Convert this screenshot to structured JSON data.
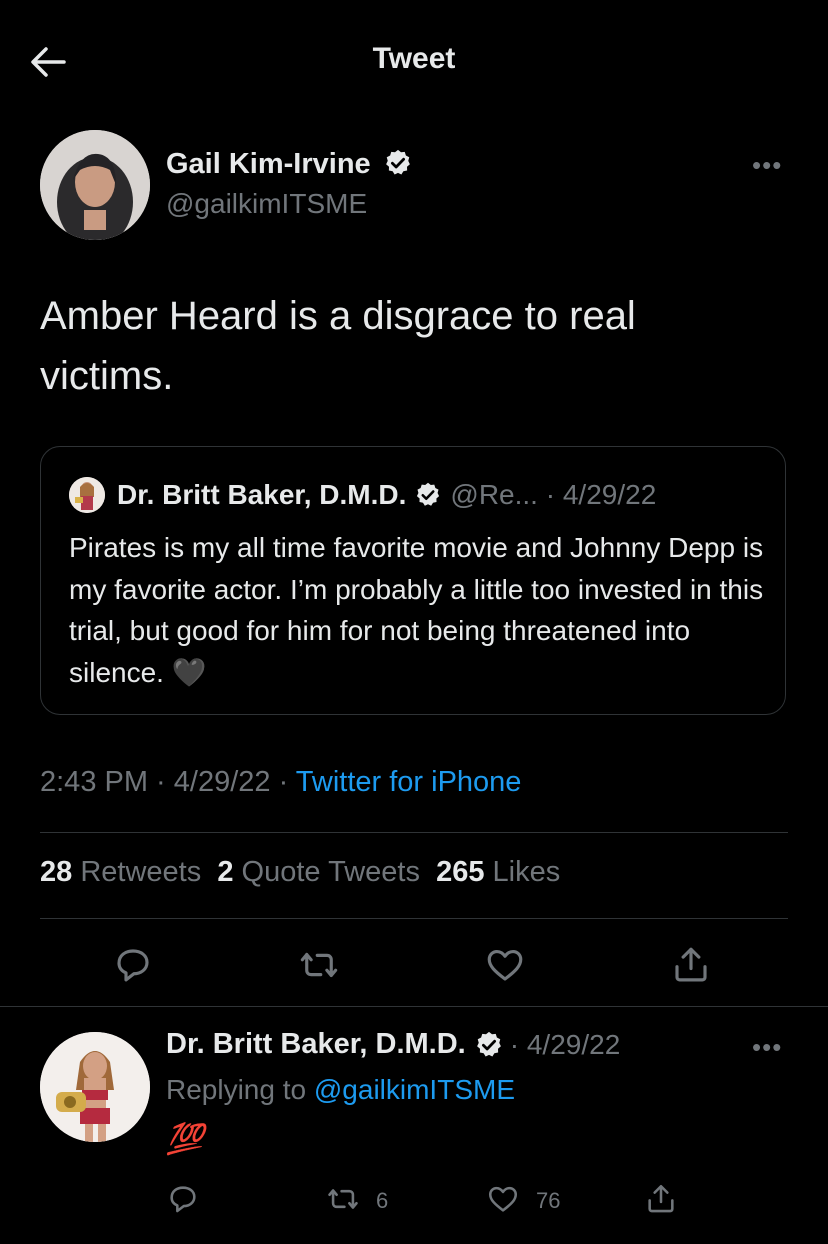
{
  "header": {
    "title": "Tweet"
  },
  "tweet": {
    "author_name": "Gail Kim-Irvine",
    "author_handle": "@gailkimITSME",
    "more": "•••",
    "text": "Amber Heard is a disgrace to real victims.",
    "quote": {
      "author_name": "Dr. Britt Baker, D.M.D.",
      "handle_date": "@Re... · 4/29/22",
      "text": "Pirates is my all time favorite movie and Johnny Depp is my favorite actor. I’m probably a little too invested in this trial, but good for him for not being threatened into silence. 🖤"
    },
    "time": "2:43 PM · 4/29/22 · ",
    "source": "Twitter for iPhone",
    "stats": {
      "retweets_count": "28",
      "retweets_label": "Retweets",
      "quotes_count": "2",
      "quotes_label": "Quote Tweets",
      "likes_count": "265",
      "likes_label": "Likes"
    }
  },
  "reply": {
    "author_name": "Dr. Britt Baker, D.M.D.",
    "date": "· 4/29/22",
    "more": "•••",
    "replying_prefix": "Replying to ",
    "replying_handle": "@gailkimITSME",
    "text": "💯",
    "retweets": "6",
    "likes": "76"
  },
  "colors": {
    "accent": "#1d9bf0",
    "muted": "#71767b",
    "text": "#e7e9ea",
    "background": "#000000"
  }
}
